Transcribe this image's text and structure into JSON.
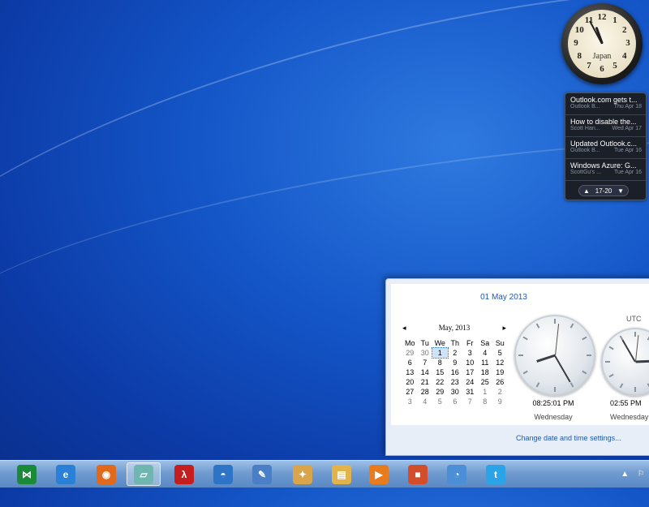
{
  "clock_gadget": {
    "city": "Japan",
    "numbers": [
      "12",
      "1",
      "2",
      "3",
      "4",
      "5",
      "6",
      "7",
      "8",
      "9",
      "10",
      "11"
    ]
  },
  "feed": {
    "items": [
      {
        "title": "Outlook.com gets t...",
        "source": "Outlook B...",
        "date": "Thu Apr 18"
      },
      {
        "title": "How to disable the...",
        "source": "Scott Han...",
        "date": "Wed Apr 17"
      },
      {
        "title": "Updated Outlook.c...",
        "source": "Outlook B...",
        "date": "Tue Apr 16"
      },
      {
        "title": "Windows Azure: G...",
        "source": "ScottGu's ...",
        "date": "Tue Apr 16"
      }
    ],
    "pager": {
      "prev": "▲",
      "range": "17-20",
      "next": "▼"
    }
  },
  "flyout": {
    "date_heading": "01 May 2013",
    "calendar": {
      "prev": "◂",
      "next": "▸",
      "month_label": "May, 2013",
      "weekdays": [
        "Mo",
        "Tu",
        "We",
        "Th",
        "Fr",
        "Sa",
        "Su"
      ],
      "weeks": [
        [
          "29",
          "30",
          "1",
          "2",
          "3",
          "4",
          "5"
        ],
        [
          "6",
          "7",
          "8",
          "9",
          "10",
          "11",
          "12"
        ],
        [
          "13",
          "14",
          "15",
          "16",
          "17",
          "18",
          "19"
        ],
        [
          "20",
          "21",
          "22",
          "23",
          "24",
          "25",
          "26"
        ],
        [
          "27",
          "28",
          "29",
          "30",
          "31",
          "1",
          "2"
        ],
        [
          "3",
          "4",
          "5",
          "6",
          "7",
          "8",
          "9"
        ]
      ]
    },
    "local_clock": {
      "time": "08:25:01 PM",
      "day": "Wednesday"
    },
    "utc_clock": {
      "label": "UTC",
      "time": "02:55 PM",
      "day": "Wednesday"
    },
    "settings_link": "Change date and time settings..."
  },
  "taskbar": {
    "apps": [
      {
        "name": "visual-studio-icon",
        "glyph": "⋈",
        "color": "#1a8a3a",
        "active": false
      },
      {
        "name": "internet-explorer-icon",
        "glyph": "e",
        "color": "#2a7fd6",
        "active": false
      },
      {
        "name": "firefox-icon",
        "glyph": "◉",
        "color": "#e0691b",
        "active": false
      },
      {
        "name": "notes-app-icon",
        "glyph": "▱",
        "color": "#6fb6b0",
        "active": true
      },
      {
        "name": "adobe-reader-icon",
        "glyph": "λ",
        "color": "#c41e1e",
        "active": false
      },
      {
        "name": "live-writer-icon",
        "glyph": "◓",
        "color": "#2e74c6",
        "active": false
      },
      {
        "name": "paint-brush-icon",
        "glyph": "✎",
        "color": "#4a7fc8",
        "active": false
      },
      {
        "name": "paint-palette-icon",
        "glyph": "✦",
        "color": "#d9a44a",
        "active": false
      },
      {
        "name": "file-explorer-icon",
        "glyph": "▤",
        "color": "#e1b34a",
        "active": false
      },
      {
        "name": "media-player-icon",
        "glyph": "▶",
        "color": "#e77b1e",
        "active": false
      },
      {
        "name": "office-icon",
        "glyph": "■",
        "color": "#d44d2a",
        "active": false
      },
      {
        "name": "github-icon",
        "glyph": "◔",
        "color": "#4d8fd6",
        "active": false
      },
      {
        "name": "twitter-icon",
        "glyph": "t",
        "color": "#2aa4e6",
        "active": false
      }
    ],
    "tray": {
      "expand": "▲",
      "flag": "⚐"
    }
  }
}
